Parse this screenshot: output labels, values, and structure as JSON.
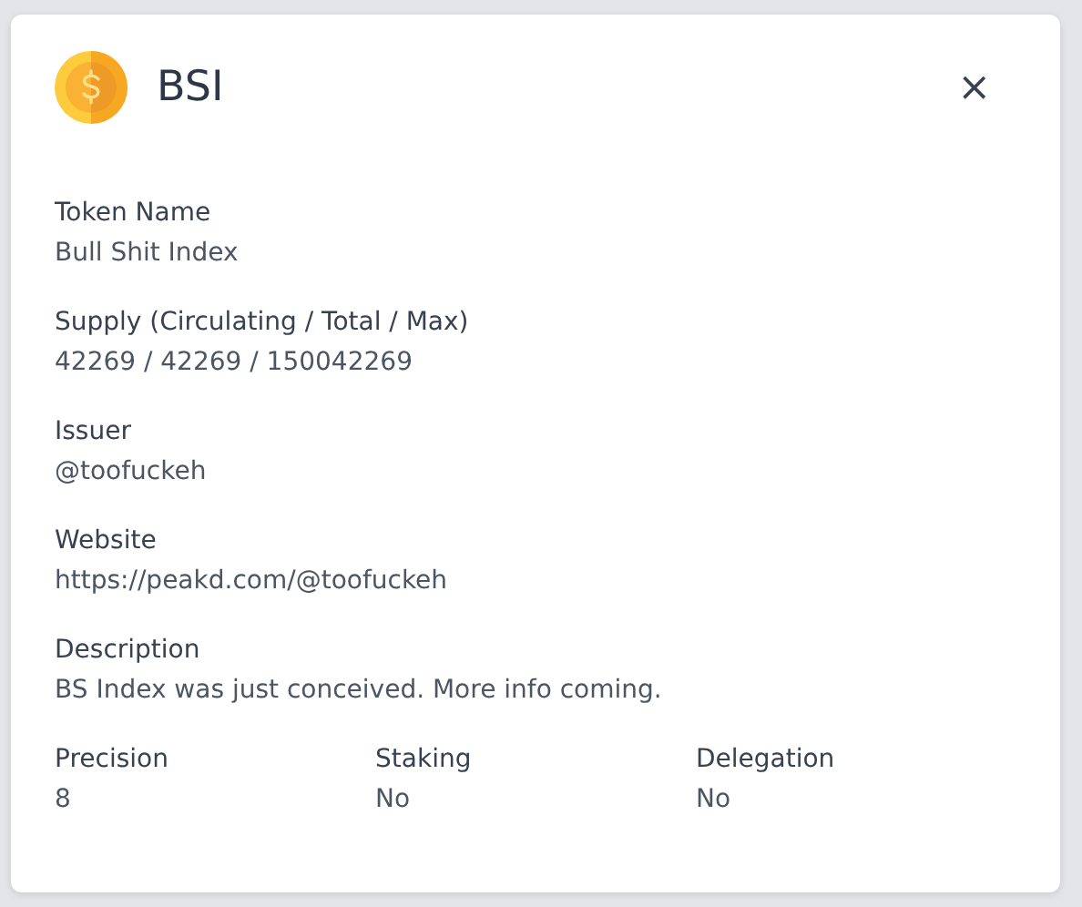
{
  "dialog": {
    "title": "BSI",
    "close": "×",
    "fields": [
      {
        "label": "Token Name",
        "value": "Bull Shit Index"
      },
      {
        "label": "Supply (Circulating / Total / Max)",
        "value": "42269 / 42269 / 150042269"
      },
      {
        "label": "Issuer",
        "value": "@toofuckeh"
      },
      {
        "label": "Website",
        "value": "https://peakd.com/@toofuckeh"
      },
      {
        "label": "Description",
        "value": "BS Index was just conceived. More info coming."
      }
    ],
    "properties": [
      {
        "label": "Precision",
        "value": "8"
      },
      {
        "label": "Staking",
        "value": "No"
      },
      {
        "label": "Delegation",
        "value": "No"
      }
    ]
  }
}
